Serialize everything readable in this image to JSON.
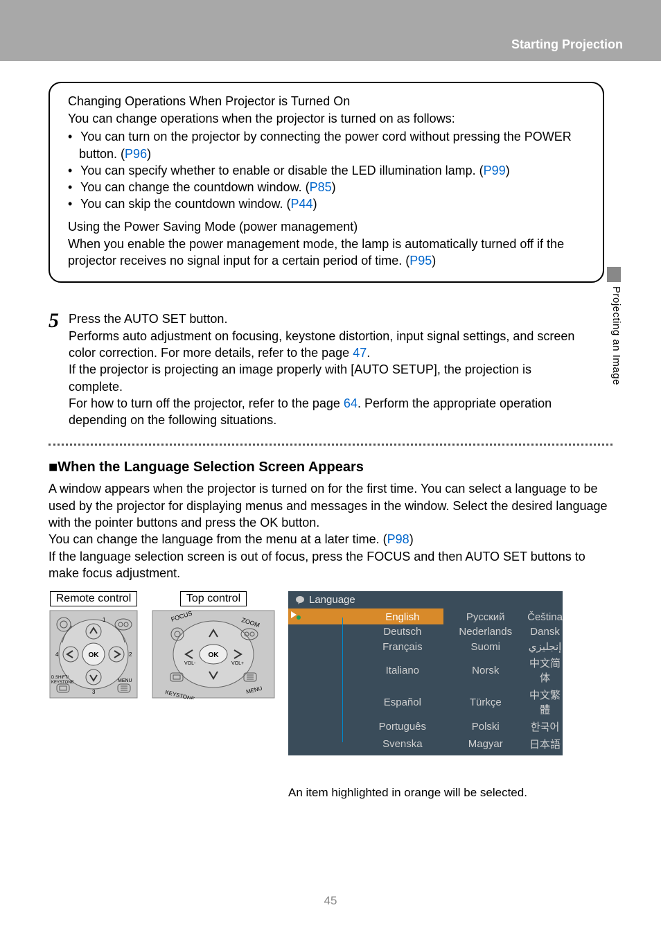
{
  "header": {
    "title": "Starting Projection"
  },
  "sidebar": {
    "label": "Projecting an Image"
  },
  "box": {
    "h1": "Changing Operations When Projector is Turned On",
    "p1": "You can change operations when the projector is turned on as follows:",
    "b1a": "You can turn on the projector by connecting the power cord without pressing the ",
    "b1b": "POWER",
    "b1c": " button. (",
    "b1link": "P96",
    "b2a": "You can specify whether to enable or disable the LED illumination lamp. (",
    "b2link": "P99",
    "b3a": "You can change the countdown window. (",
    "b3link": "P85",
    "b4a": "You can skip the countdown window. (",
    "b4link": "P44",
    "h2": "Using the Power Saving Mode (power management)",
    "p2a": "When you enable the power management mode, the lamp is automatically turned off if the projector receives no signal input for a certain period of time. (",
    "p2link": "P95"
  },
  "step": {
    "num": "5",
    "title": "Press the AUTO SET button.",
    "p1a": "Performs auto adjustment on focusing, keystone distortion, input signal settings, and screen color correction. For more details, refer to the page ",
    "p1link": "47",
    "p2": "If the projector is projecting an image properly with [AUTO SETUP], the projection is complete.",
    "p3a": "For how to turn off the projector, refer to the page ",
    "p3link": "64",
    "p3b": ". Perform the appropriate operation depending on the following situations."
  },
  "section": {
    "heading": "When the Language Selection Screen Appears",
    "p1": "A window appears when the projector is turned on for the first time. You can select a language to be used by the projector for displaying menus and messages in the window. Select the desired language with the pointer buttons and press the ",
    "p1b": "OK",
    "p1c": " button.",
    "p2a": "You can change the language from the menu at a later time. (",
    "p2link": "P98",
    "p3a": "If the language selection screen is out of focus, press the ",
    "p3b": "FOCUS",
    "p3c": " and then ",
    "p3d": "AUTO SET",
    "p3e": " buttons to make focus adjustment."
  },
  "controls": {
    "remote": "Remote control",
    "top": "Top control"
  },
  "language": {
    "header": "Language",
    "rows": [
      [
        "English",
        "Русский",
        "Čeština"
      ],
      [
        "Deutsch",
        "Nederlands",
        "Dansk"
      ],
      [
        "Français",
        "Suomi",
        "إنجليزي"
      ],
      [
        "Italiano",
        "Norsk",
        "中文简体"
      ],
      [
        "Español",
        "Türkçe",
        "中文繁體"
      ],
      [
        "Português",
        "Polski",
        "한국어"
      ],
      [
        "Svenska",
        "Magyar",
        "日本語"
      ]
    ],
    "caption": "An item highlighted in orange will be selected."
  },
  "remote_labels": {
    "ok": "OK",
    "menu": "MENU",
    "dshift": "D.SHIFT/\nKEYSTONE",
    "n1": "1",
    "n2": "2",
    "n3": "3",
    "n4": "4"
  },
  "top_labels": {
    "ok": "OK",
    "focus": "FOCUS",
    "zoom": "ZOOM",
    "keystone": "KEYSTONE",
    "menu": "MENU",
    "volm": "VOL-",
    "volp": "VOL+"
  },
  "page": "45"
}
